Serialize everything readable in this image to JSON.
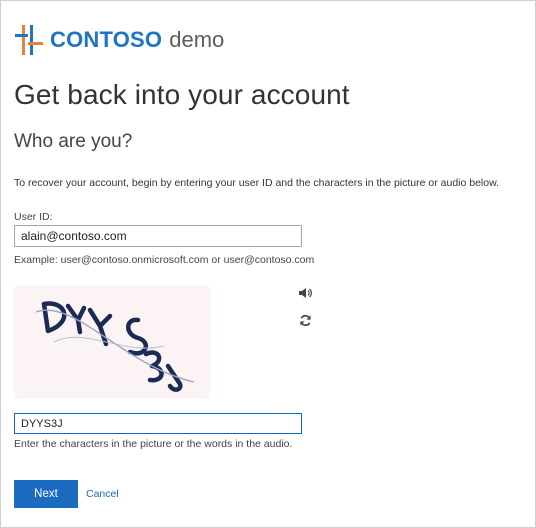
{
  "logo": {
    "brand": "CONTOSO",
    "suffix": "demo",
    "colors": {
      "brand_blue": "#1f74c4",
      "mark_orange": "#e8833a",
      "suffix_gray": "#5e5e5e"
    }
  },
  "page": {
    "title": "Get back into your account",
    "section_title": "Who are you?",
    "intro": "To recover your account, begin by entering your user ID and the characters in the picture or audio below."
  },
  "user_id": {
    "label": "User ID:",
    "value": "alain@contoso.com",
    "example": "Example: user@contoso.onmicrosoft.com or user@contoso.com"
  },
  "captcha": {
    "image_text": "DYYS3J",
    "audio_icon": "speaker-icon",
    "refresh_icon": "refresh-icon",
    "input_value": "DYYS3J",
    "help": "Enter the characters in the picture or the words in the audio."
  },
  "actions": {
    "next_label": "Next",
    "cancel_label": "Cancel",
    "primary_color": "#1b6cc0"
  }
}
